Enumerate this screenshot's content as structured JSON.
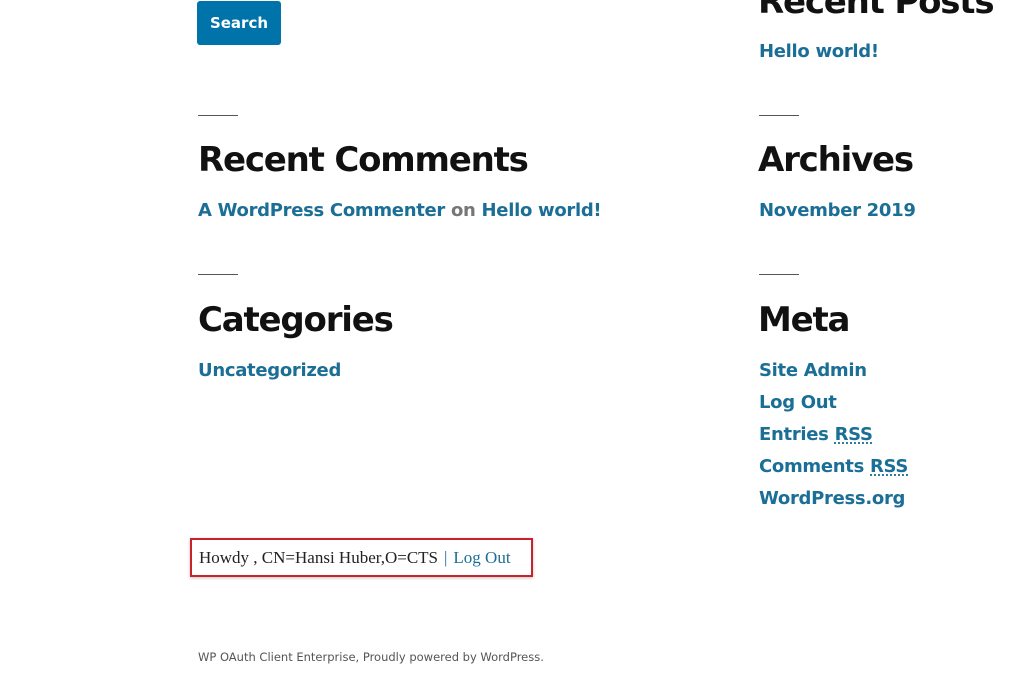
{
  "search": {
    "button_label": "Search"
  },
  "recent_posts": {
    "title": "Recent Posts",
    "items": [
      "Hello world!"
    ]
  },
  "recent_comments": {
    "title": "Recent Comments",
    "author": "A WordPress Commenter",
    "connector": "on",
    "post": "Hello world!"
  },
  "archives": {
    "title": "Archives",
    "items": [
      "November 2019"
    ]
  },
  "categories": {
    "title": "Categories",
    "items": [
      "Uncategorized"
    ]
  },
  "meta": {
    "title": "Meta",
    "site_admin": "Site Admin",
    "log_out": "Log Out",
    "entries_prefix": "Entries",
    "comments_prefix": "Comments",
    "rss": "RSS",
    "wordpress_org": "WordPress.org"
  },
  "greeting": {
    "text": "Howdy , CN=Hansi Huber,O=CTS",
    "separator": "|",
    "logout_label": "Log Out"
  },
  "footer": {
    "text": "WP OAuth Client Enterprise, Proudly powered by WordPress."
  },
  "colors": {
    "link": "#1b6e96",
    "button_bg": "#0073aa",
    "highlight_border": "#c8232c"
  }
}
